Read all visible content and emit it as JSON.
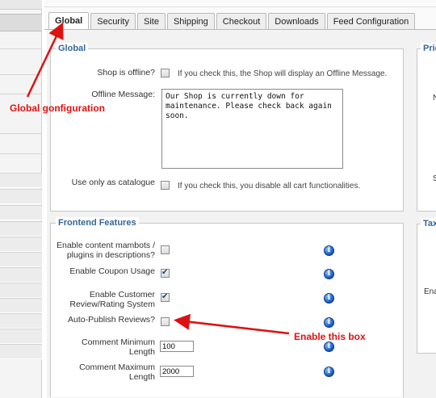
{
  "tabs": [
    "Global",
    "Security",
    "Site",
    "Shipping",
    "Checkout",
    "Downloads",
    "Feed Configuration"
  ],
  "global": {
    "legend": "Global",
    "shop_offline_label": "Shop is offline?",
    "shop_offline_checked": false,
    "shop_offline_hint": "If you check this, the Shop will display an Offline Message.",
    "offline_message_label": "Offline Message:",
    "offline_message_value": "Our Shop is currently down for maintenance. Please check back again soon.",
    "catalogue_label": "Use only as catalogue",
    "catalogue_checked": false,
    "catalogue_hint": "If you check this, you disable all cart functionalities."
  },
  "frontend": {
    "legend": "Frontend Features",
    "mambots_label": "Enable content mambots / plugins in descriptions?",
    "mambots_checked": false,
    "coupon_label": "Enable Coupon Usage",
    "coupon_checked": true,
    "review_label": "Enable Customer Review/Rating System",
    "review_checked": true,
    "autopublish_label": "Auto-Publish Reviews?",
    "autopublish_checked": false,
    "comment_min_label": "Comment Minimum Length",
    "comment_min_value": "100",
    "comment_max_label": "Comment Maximum Length",
    "comment_max_value": "2000"
  },
  "right_panels": {
    "top_legend": "Pric",
    "bottom_legend": "Tax",
    "bottom_label": "Ena"
  },
  "annotations": {
    "global_config": "Global gonfiguration",
    "enable_box": "Enable this box",
    "color": "#dd1111"
  }
}
